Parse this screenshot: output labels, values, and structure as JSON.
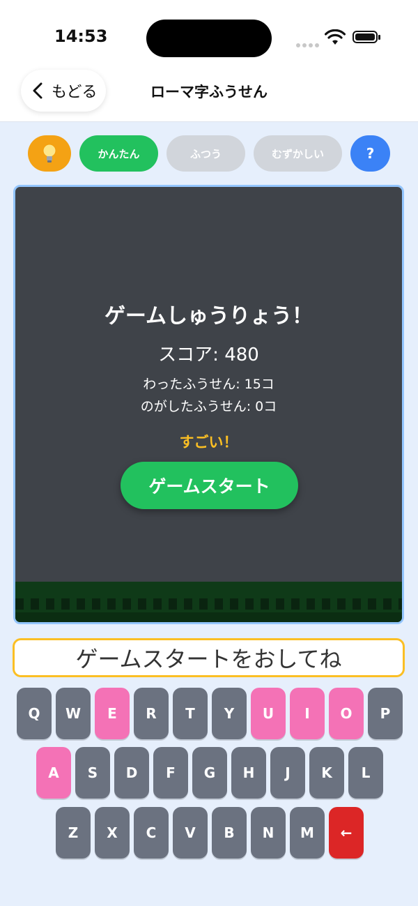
{
  "status": {
    "time": "14:53"
  },
  "nav": {
    "back_label": "もどる",
    "title": "ローマ字ふうせん"
  },
  "toolbar": {
    "hint_icon": "lightbulb-icon",
    "difficulties": [
      {
        "label": "かんたん",
        "selected": true
      },
      {
        "label": "ふつう",
        "selected": false
      },
      {
        "label": "むずかしい",
        "selected": false
      }
    ],
    "help_label": "?"
  },
  "result": {
    "title": "ゲームしゅうりょう！",
    "score": "スコア: 480",
    "popped": "わったふうせん: 15コ",
    "missed": "のがしたふうせん: 0コ",
    "praise": "すごい！",
    "start_label": "ゲームスタート"
  },
  "prompt": "ゲームスタートをおしてね",
  "keyboard": {
    "row1": [
      "Q",
      "W",
      "E",
      "R",
      "T",
      "Y",
      "U",
      "I",
      "O",
      "P"
    ],
    "row2": [
      "A",
      "S",
      "D",
      "F",
      "G",
      "H",
      "J",
      "K",
      "L"
    ],
    "row3": [
      "Z",
      "X",
      "C",
      "V",
      "B",
      "N",
      "M",
      "←"
    ],
    "highlighted_keys": [
      "E",
      "U",
      "I",
      "O",
      "A"
    ],
    "colors": {
      "key": "#6b7280",
      "vowel": "#f472b6",
      "backspace": "#dc2626"
    }
  },
  "colors": {
    "accent_green": "#22c15e",
    "hint_orange": "#f4a214",
    "help_blue": "#3b82f6",
    "prompt_border": "#fbbf24"
  }
}
